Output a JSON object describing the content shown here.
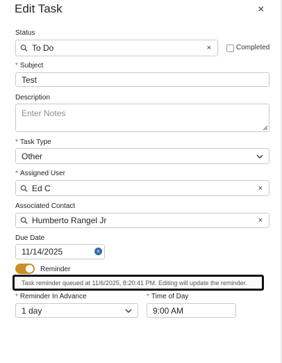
{
  "dialog": {
    "title": "Edit Task",
    "close_glyph": "×"
  },
  "status": {
    "label": "Status",
    "value": "To Do",
    "clear_glyph": "×",
    "completed_label": "Completed",
    "completed_checked": false
  },
  "subject": {
    "required_mark": "*",
    "label": "Subject",
    "value": "Test"
  },
  "description": {
    "label": "Description",
    "placeholder": "Enter Notes"
  },
  "task_type": {
    "required_mark": "*",
    "label": "Task Type",
    "value": "Other"
  },
  "assigned_user": {
    "required_mark": "*",
    "label": "Assigned User",
    "value": "Ed C",
    "clear_glyph": "×"
  },
  "associated_contact": {
    "label": "Associated Contact",
    "value": "Humberto Rangel Jr",
    "clear_glyph": "×"
  },
  "due_date": {
    "label": "Due Date",
    "value": "11/14/2025",
    "clear_glyph": "×"
  },
  "reminder": {
    "label": "Reminder",
    "enabled": true,
    "notice": "Task reminder queued at 11/6/2025, 8:20:41 PM. Editing will update the reminder."
  },
  "reminder_in_advance": {
    "required_mark": "*",
    "label": "Reminder In Advance",
    "value": "1 day"
  },
  "time_of_day": {
    "required_mark": "*",
    "label": "Time of Day",
    "value": "9:00 AM"
  },
  "colors": {
    "toggle_on": "#c98e26",
    "required": "#d63b2a",
    "date_clear": "#2f6ea8",
    "notice_border": "#111111"
  },
  "icons": [
    "search-icon",
    "close-icon",
    "chevron-down-icon",
    "resize-handle-icon"
  ]
}
